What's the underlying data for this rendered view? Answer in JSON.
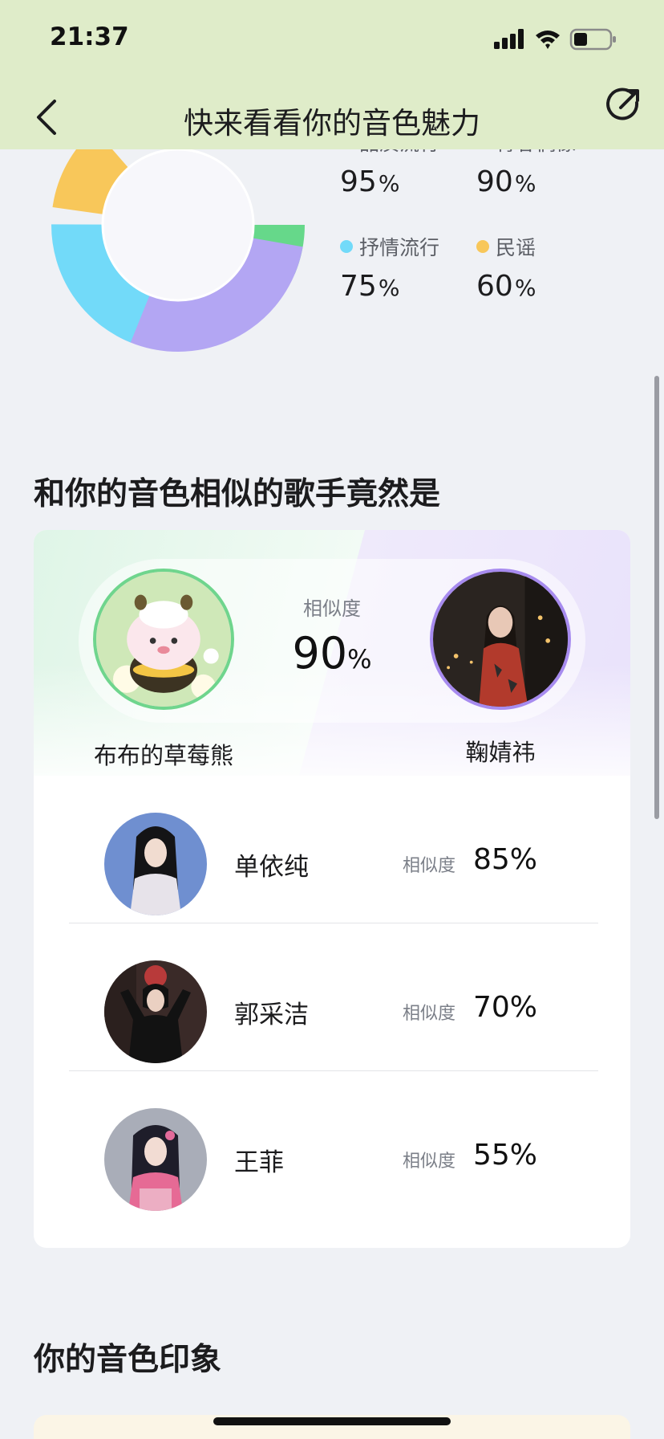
{
  "status_bar": {
    "time": "21:37"
  },
  "nav": {
    "title": "快来看看你的音色魅力"
  },
  "donut": {
    "items": [
      {
        "label": "品质流行",
        "value": "95",
        "unit": "%",
        "color": "#66d88a"
      },
      {
        "label": "青春偶像",
        "value": "90",
        "unit": "%",
        "color": "#b3a6f3"
      },
      {
        "label": "抒情流行",
        "value": "75",
        "unit": "%",
        "color": "#72daf9"
      },
      {
        "label": "民谣",
        "value": "60",
        "unit": "%",
        "color": "#f8c75a"
      }
    ]
  },
  "similar": {
    "title": "和你的音色相似的歌手竟然是",
    "user_name": "布布的草莓熊",
    "match_name": "鞠婧祎",
    "sim_label": "相似度",
    "top_value": "90",
    "top_unit": "%",
    "singers": [
      {
        "name": "单依纯",
        "sim_label": "相似度",
        "value": "85%"
      },
      {
        "name": "郭采洁",
        "sim_label": "相似度",
        "value": "70%"
      },
      {
        "name": "王菲",
        "sim_label": "相似度",
        "value": "55%"
      }
    ]
  },
  "impression": {
    "title": "你的音色印象"
  },
  "colors": {
    "header_bg": "#dfecc9",
    "page_bg": "#eff1f5",
    "user_ring": "#6fd58d",
    "match_ring": "#a78bef"
  }
}
